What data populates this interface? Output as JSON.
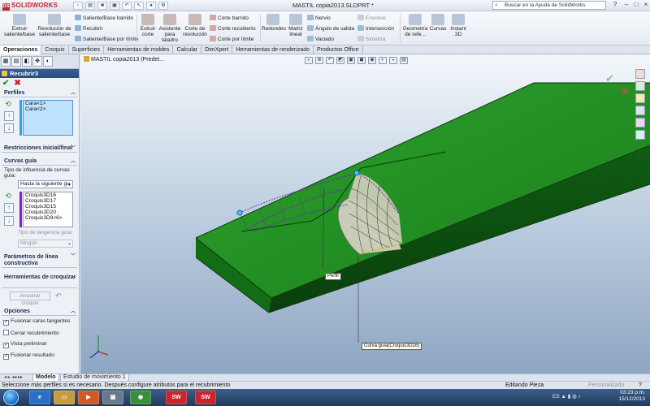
{
  "app": {
    "logo_text": "SOLIDWORKS",
    "document_title": "MASTIL copia2013.SLDPRT *",
    "help_search_placeholder": "Buscar en la Ayuda de SolidWorks"
  },
  "ribbon": {
    "extruir_saliente": "Extruir saliente/base",
    "revolucion_saliente": "Revolución de saliente/base",
    "saliente_barrido": "Saliente/Base barrido",
    "recubrir": "Recubrir",
    "saliente_limite": "Saliente/Base por límite",
    "extruir_corte": "Extruir corte",
    "asistente_taladro": "Asistente para taladro",
    "corte_revolucion": "Corte de revolución",
    "corte_barrido": "Corte barrido",
    "corte_recubierto": "Corte recubierto",
    "corte_limite": "Corte por límite",
    "redondeo": "Redondeo",
    "matriz_lineal": "Matriz lineal",
    "nervio": "Nervio",
    "angulo_salida": "Ángulo de salida",
    "vaciado": "Vaciado",
    "envolver": "Envolver",
    "interseccion": "Intersección",
    "simetria": "Simetría",
    "geometria_referencia": "Geometría de refe...",
    "curvas": "Curvas",
    "instant3d": "Instant 3D"
  },
  "command_tabs": [
    "Operaciones",
    "Croquis",
    "Superficies",
    "Herramientas de moldes",
    "Calcular",
    "DimXpert",
    "Herramientas de renderizado",
    "Productos Office"
  ],
  "property_manager": {
    "title": "Recubrir3",
    "ok_symbol": "✔",
    "cancel_symbol": "✖",
    "perfiles": {
      "header": "Perfiles",
      "items": [
        "Cara<1>",
        "Cara<2>"
      ]
    },
    "restricciones_header": "Restricciones inicial/final",
    "curvas_guia": {
      "header": "Curvas guía",
      "influence_label": "Tipo de influencia de curvas guía:",
      "influence_value": "Hasta la siguiente gu",
      "items": [
        "Croquis3D16",
        "Croquis3D17",
        "Croquis3D15",
        "Croquis3D20",
        "Croquis3D9<6>"
      ],
      "tangency_label": "Tipo de tangencia guía:",
      "tangency_value": "Ningún"
    },
    "parametros_header": "Parámetros de línea constructiva",
    "herramientas_header": "Herramientas de croquizar",
    "arrastrar_label": "Arrastrar croquis",
    "opciones": {
      "header": "Opciones",
      "fusionar_caras": "Fusionar caras tangentes",
      "cerrar_recubrimiento": "Cerrar recubrimiento",
      "vista_preliminar": "Vista preliminar",
      "fusionar_resultado": "Fusionar resultado"
    }
  },
  "viewport": {
    "tree_label": "MASTIL copia2013 (Predet...",
    "callout_perfil": "Perfil",
    "callout_curva": "Curva guía(Croquis3D16)"
  },
  "bottom_tabs": [
    "Modelo",
    "Estudio de movimiento 1"
  ],
  "status": {
    "message": "Seleccione más perfiles si es necesario. Después configure atributos para el recubrimiento",
    "mode": "Editando Pieza",
    "custom": "Personalizado"
  },
  "taskbar": {
    "language": "ES",
    "time": "03:23 p.m.",
    "date": "15/12/2013"
  },
  "colors": {
    "model_green": "#1f8a1f",
    "model_dark_green": "#0e4d10",
    "preview_surface": "#c9cbb6",
    "guide_purple": "#8a1cc9",
    "accent_blue": "#2a4a7c"
  }
}
